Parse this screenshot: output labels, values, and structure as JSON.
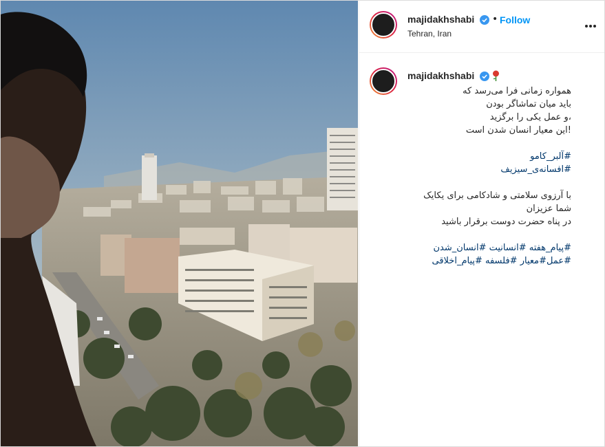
{
  "colors": {
    "link_blue": "#0095f6",
    "hashtag_blue": "#00376b",
    "text": "#262626",
    "verified_blue": "#3897f0"
  },
  "header": {
    "username": "majidakhshabi",
    "separator": "•",
    "follow_label": "Follow",
    "location": "Tehran, Iran",
    "more_icon": "more-horizontal-icon"
  },
  "caption": {
    "username": "majidakhshabi",
    "emoji": "rose-icon",
    "lines": [
      "همواره زمانی فرا می‌رسد که",
      "باید میان تماشاگر بودن",
      "،و عمل یکی را برگزید",
      "!این معیار انسان شدن است"
    ],
    "hashtags_1": [
      "#آلبر_کامو",
      "#افسانه‌ی_سیزیف"
    ],
    "message_lines": [
      "با آرزوی سلامتی و شادکامی برای یکایک",
      "شما عزیزان",
      "در پناه حضرت دوست برقرار باشید"
    ],
    "hashtag_lines": [
      "#پیام_هفته #انسانیت #انسان_شدن",
      "#عمل#معیار #فلسفه #پیام_اخلاقی"
    ]
  }
}
